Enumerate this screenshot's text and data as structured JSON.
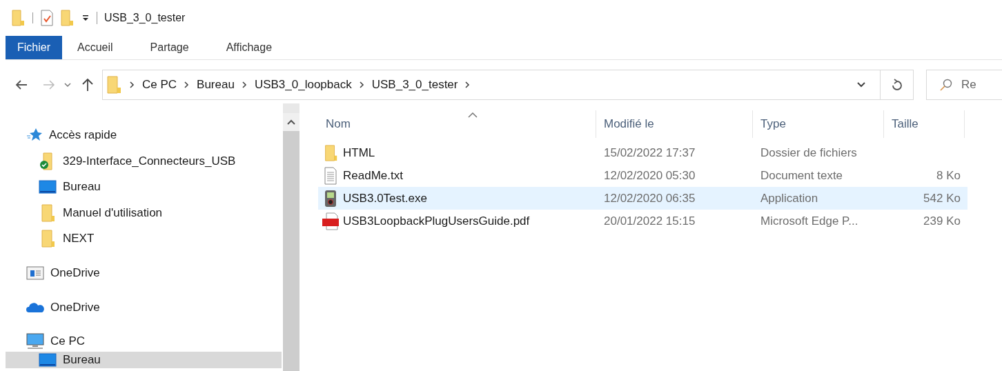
{
  "window": {
    "title": "USB_3_0_tester"
  },
  "ribbon_tabs": [
    {
      "label": "Fichier",
      "kind": "file"
    },
    {
      "label": "Accueil",
      "kind": "tab"
    },
    {
      "label": "Partage",
      "kind": "tab"
    },
    {
      "label": "Affichage",
      "kind": "tab"
    }
  ],
  "address_bar": {
    "path": [
      "Ce PC",
      "Bureau",
      "USB3_0_loopback",
      "USB_3_0_tester"
    ]
  },
  "search": {
    "placeholder": "Re"
  },
  "sidebar": {
    "items": [
      {
        "label": "Accès rapide",
        "kind": "star",
        "selected": false,
        "children": [
          {
            "label": "329-Interface_Connecteurs_USB",
            "kind": "synced-folder",
            "selected": false
          },
          {
            "label": "Bureau",
            "kind": "desktop",
            "selected": false
          },
          {
            "label": "Manuel d'utilisation",
            "kind": "folder",
            "selected": false
          },
          {
            "label": "NEXT",
            "kind": "folder",
            "selected": false
          }
        ]
      },
      {
        "label": "OneDrive",
        "kind": "window",
        "selected": false
      },
      {
        "label": "OneDrive",
        "kind": "cloud",
        "selected": false
      },
      {
        "label": "Ce PC",
        "kind": "pc",
        "selected": false,
        "children": [
          {
            "label": "Bureau",
            "kind": "desktop",
            "selected": true
          }
        ]
      }
    ]
  },
  "table": {
    "columns": [
      "Nom",
      "Modifié le",
      "Type",
      "Taille"
    ],
    "rows": [
      {
        "name": "HTML",
        "kind": "folder",
        "modified": "15/02/2022 17:37",
        "type": "Dossier de fichiers",
        "size": null,
        "selected": false
      },
      {
        "name": "ReadMe.txt",
        "kind": "text",
        "modified": "12/02/2020 05:30",
        "type": "Document texte",
        "size": "8 Ko",
        "selected": false
      },
      {
        "name": "USB3.0Test.exe",
        "kind": "exe",
        "modified": "12/02/2020 06:35",
        "type": "Application",
        "size": "542 Ko",
        "selected": true
      },
      {
        "name": "USB3LoopbackPlugUsersGuide.pdf",
        "kind": "pdf",
        "modified": "20/01/2022 15:15",
        "type": "Microsoft Edge P...",
        "size": "239 Ko",
        "selected": false
      }
    ]
  }
}
